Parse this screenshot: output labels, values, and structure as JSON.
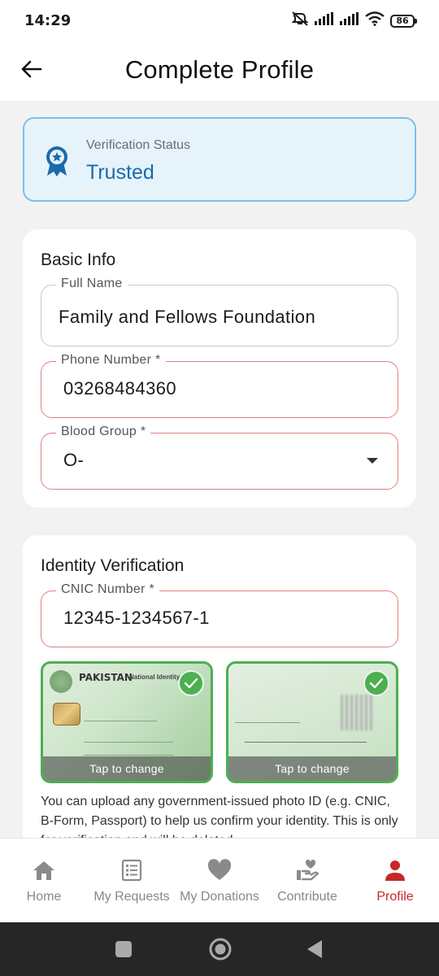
{
  "status_bar": {
    "time": "14:29",
    "battery": "86",
    "icons": [
      "mute-icon",
      "signal-icon",
      "signal-icon",
      "wifi-icon",
      "battery-icon"
    ]
  },
  "app_bar": {
    "title": "Complete Profile",
    "back_icon": "arrow-left-icon"
  },
  "verification": {
    "label": "Verification Status",
    "value": "Trusted",
    "icon": "award-badge-icon",
    "accent": "#1c6aa9"
  },
  "basic_info": {
    "title": "Basic Info",
    "full_name": {
      "label": "Full Name",
      "value": "Family and Fellows Foundation"
    },
    "phone": {
      "label": "Phone Number *",
      "value": "03268484360"
    },
    "blood_group": {
      "label": "Blood Group *",
      "value": "O-"
    }
  },
  "identity": {
    "title": "Identity Verification",
    "cnic": {
      "label": "CNIC Number *",
      "value": "12345-1234567-1"
    },
    "front_image": {
      "overlay": "Tap to change",
      "card_title": "PAKISTAN",
      "card_subtitle": "National Identity Card"
    },
    "back_image": {
      "overlay": "Tap to change"
    },
    "help_text": "You can upload any government-issued photo ID (e.g. CNIC, B-Form, Passport) to help us confirm your identity. This is only for verification and will be deleted"
  },
  "bottom_nav": [
    {
      "label": "Home",
      "icon": "home-icon",
      "active": false
    },
    {
      "label": "My Requests",
      "icon": "list-icon",
      "active": false
    },
    {
      "label": "My Donations",
      "icon": "heart-icon",
      "active": false
    },
    {
      "label": "Contribute",
      "icon": "hand-heart-icon",
      "active": false
    },
    {
      "label": "Profile",
      "icon": "person-icon",
      "active": true
    }
  ],
  "colors": {
    "error_border": "#e08080",
    "success": "#4caf50",
    "active_nav": "#c62828"
  }
}
